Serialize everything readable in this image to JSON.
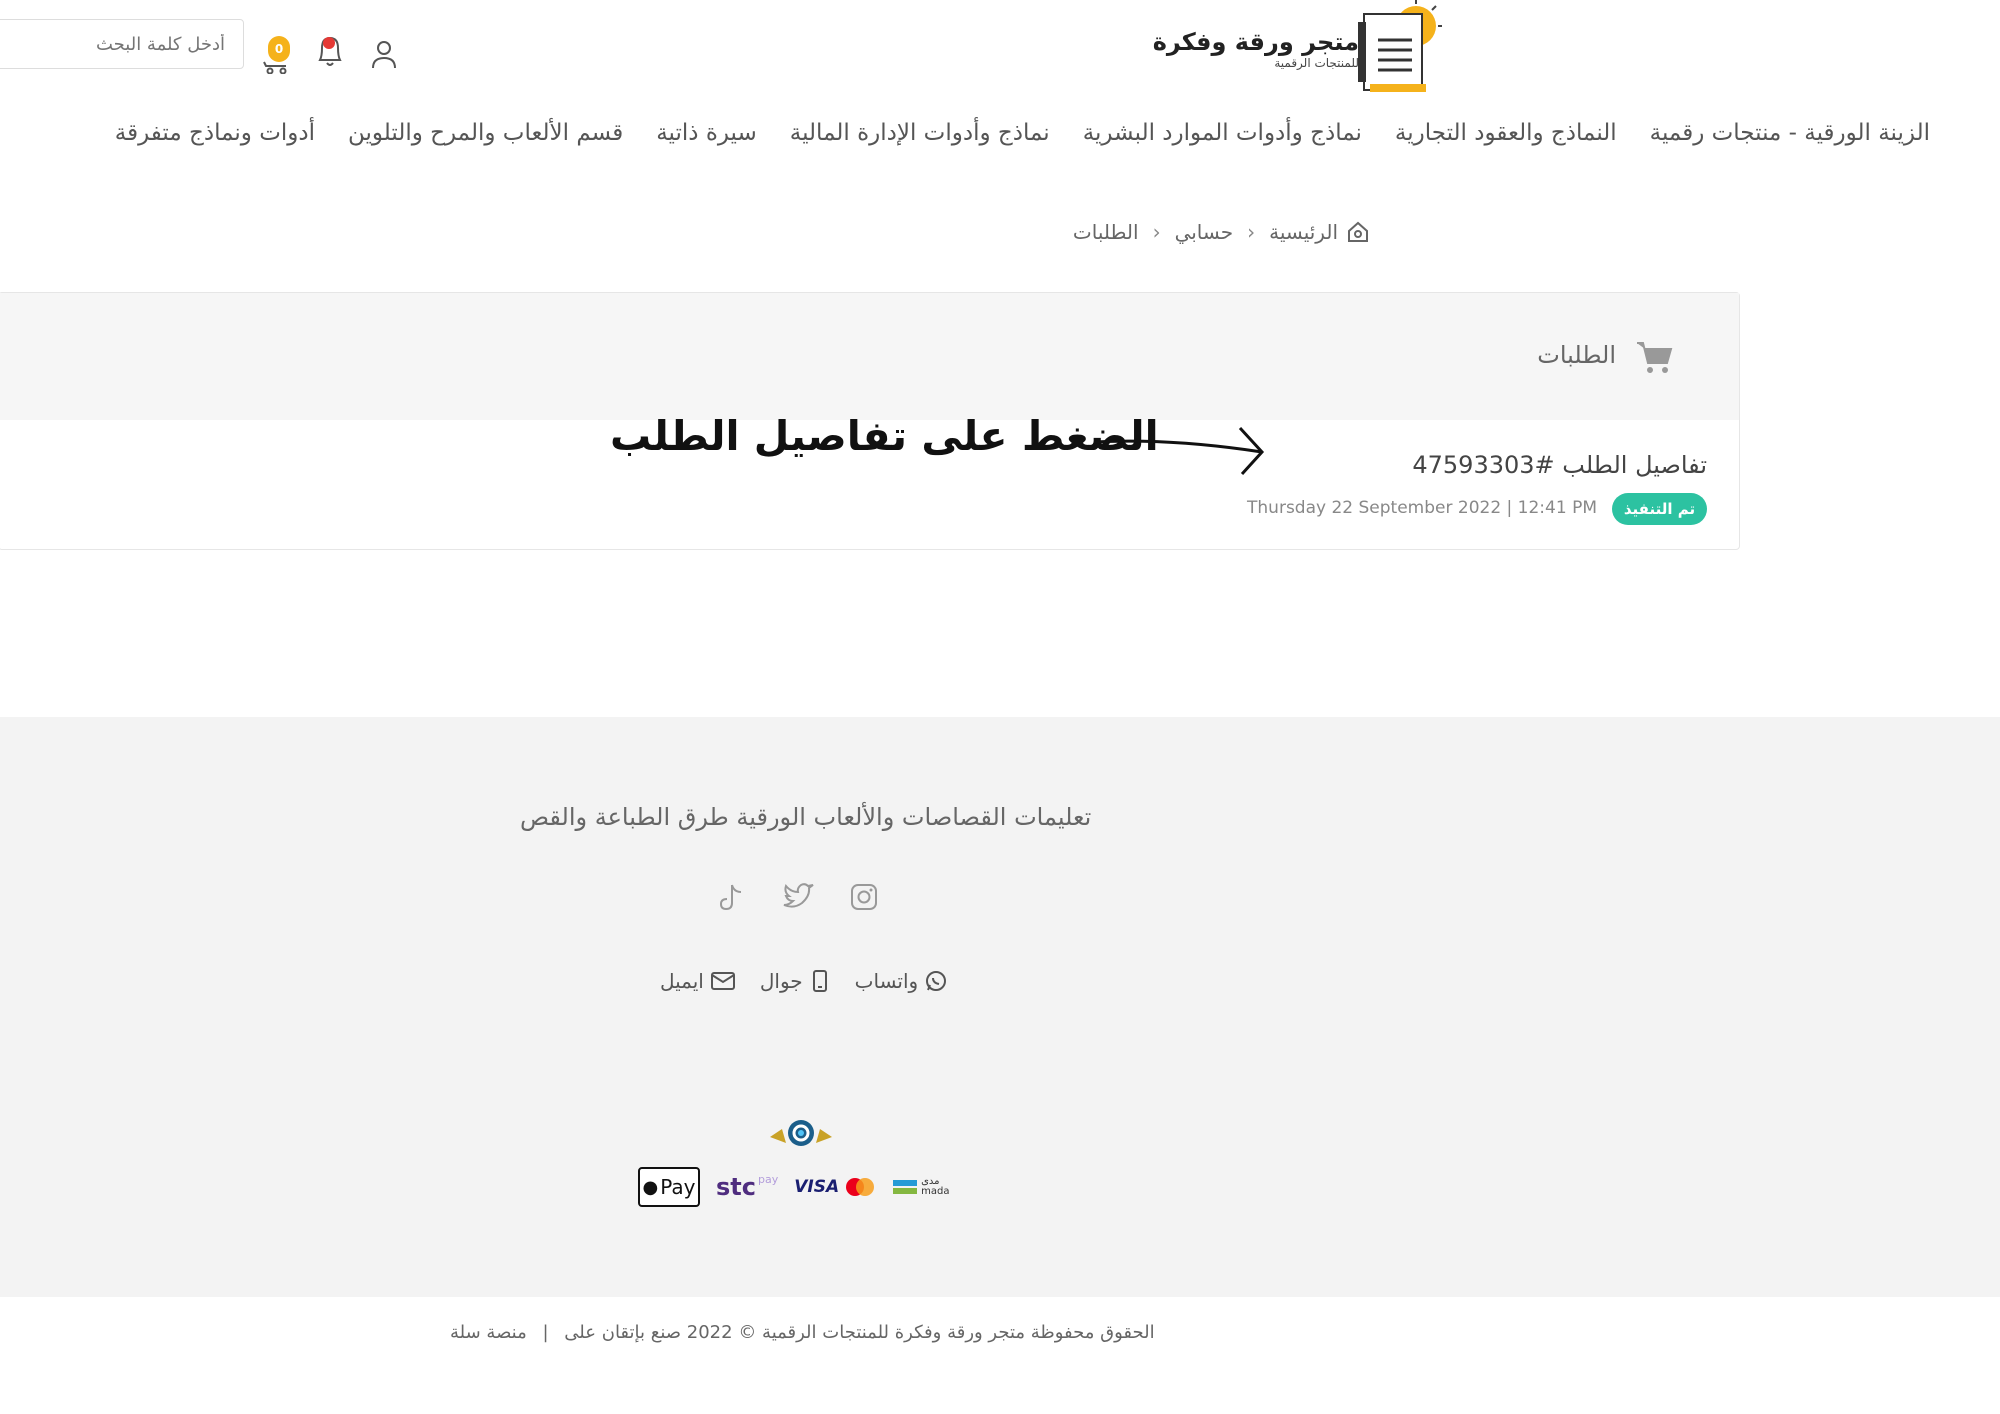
{
  "header": {
    "logo_title": "متجر ورقة وفكرة",
    "logo_subtitle": "للمنتجات الرقمية",
    "search_placeholder": "أدخل كلمة البحث",
    "cart_count": "0"
  },
  "nav": {
    "items": [
      "الزينة الورقية - منتجات رقمية",
      "النماذج والعقود التجارية",
      "نماذج وأدوات الموارد البشرية",
      "نماذج وأدوات الإدارة المالية",
      "سيرة ذاتية",
      "قسم الألعاب والمرح والتلوين",
      "أدوات ونماذج متفرقة"
    ]
  },
  "breadcrumb": {
    "home": "الرئيسية",
    "account": "حسابي",
    "current": "الطلبات"
  },
  "orders": {
    "title": "الطلبات",
    "order_link": "تفاصيل الطلب #47593303",
    "status": "تم التنفيذ",
    "date": "Thursday 22 September 2022 | 12:41 PM"
  },
  "annotation": {
    "text": "الضغط على تفاصيل الطلب"
  },
  "footer": {
    "description": "تعليمات القصاصات والألعاب الورقية طرق الطباعة والقص",
    "contacts": {
      "whatsapp": "واتساب",
      "mobile": "جوال",
      "email": "ايميل"
    },
    "payments": {
      "applepay": "Pay",
      "stc": "stc",
      "stc_small": "pay",
      "visa": "VISA",
      "mada": "mada",
      "mada_ar": "مدى"
    },
    "copyright": "الحقوق محفوظة متجر ورقة وفكرة للمنتجات الرقمية © 2022 صنع بإتقان على",
    "platform": "منصة سلة"
  },
  "colors": {
    "accent_green": "#2cc2a1",
    "badge_yellow": "#f5b21b",
    "footer_bg": "#f3f3f3"
  }
}
